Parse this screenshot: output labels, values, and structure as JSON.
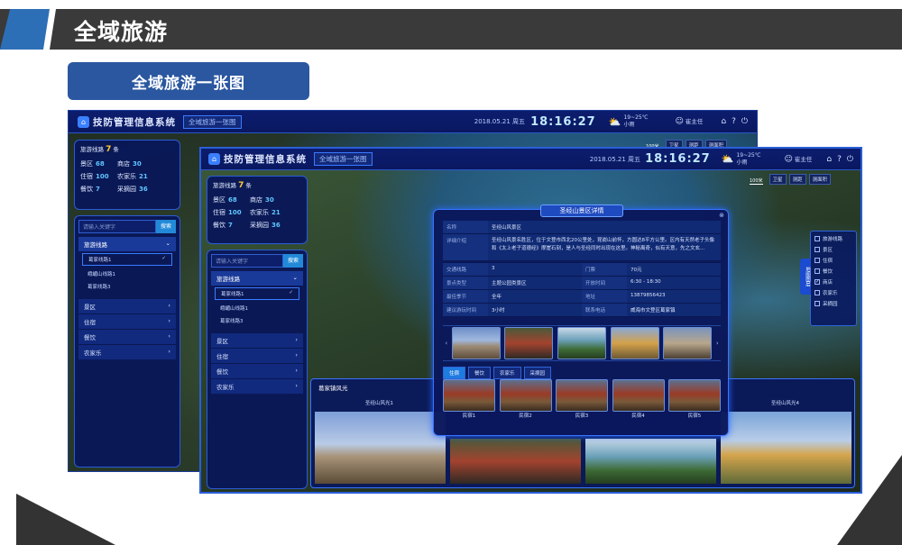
{
  "slide": {
    "title": "全域旅游",
    "subtitle": "全域旅游一张图"
  },
  "app": {
    "system_name": "技防管理信息系统",
    "active_tab": "全域旅游一张图",
    "date": "2018.05.21 周五",
    "time": "18:16:27",
    "weather_temp": "19~25℃",
    "weather_desc": "小雨",
    "user": "崔主任",
    "scale": "100米",
    "map_tools": [
      "卫星",
      "测距",
      "测面积"
    ]
  },
  "stats": {
    "route_label": "旅游线路",
    "route_count": "7",
    "route_unit": "条",
    "items": [
      {
        "label": "景区",
        "value": "68"
      },
      {
        "label": "商店",
        "value": "30"
      },
      {
        "label": "住宿",
        "value": "100"
      },
      {
        "label": "农家乐",
        "value": "21"
      },
      {
        "label": "餐饮",
        "value": "7"
      },
      {
        "label": "采摘园",
        "value": "36"
      }
    ]
  },
  "sidebar": {
    "search_placeholder": "请输入关键字",
    "search_button": "搜索",
    "route_menu": "旅游线路",
    "routes": [
      "葛家线路1",
      "峨嵋山线路1",
      "葛家线路3"
    ],
    "categories": [
      "景区",
      "住宿",
      "餐饮",
      "农家乐"
    ]
  },
  "detail": {
    "title": "圣经山景区详情",
    "rows": [
      {
        "k": "名称",
        "v": "圣经山风景区"
      },
      {
        "k": "详细介绍",
        "v": "圣经山风景名胜区，位于文登市西北20公里处，昆嵛山前怀，方圆达8平方公里。区内有天然老子头像和《太上老子道德经》摩崖石刻，是人与圣经同时出现在这里。神秘离奇，似有天意，先之文玄..."
      }
    ],
    "pairs": [
      {
        "k1": "交通线路",
        "v1": "3",
        "k2": "门票",
        "v2": "70元"
      },
      {
        "k1": "景点类型",
        "v1": "主题公园类景区",
        "k2": "开放时间",
        "v2": "6:30 - 18:30"
      },
      {
        "k1": "最佳季节",
        "v1": "全年",
        "k2": "地址",
        "v2": "13879856423"
      },
      {
        "k1": "建议游玩时间",
        "v1": "3小时",
        "k2": "联系电话",
        "v2": "威海市文登区葛家镇"
      }
    ],
    "tabs": [
      "住宿",
      "餐饮",
      "农家乐",
      "采摘园"
    ],
    "folk": [
      "民宿1",
      "民宿2",
      "民宿3",
      "民宿4",
      "民宿5"
    ]
  },
  "layers": {
    "title": "地图图层",
    "items": [
      {
        "label": "旅游线路",
        "checked": false
      },
      {
        "label": "景区",
        "checked": false
      },
      {
        "label": "住宿",
        "checked": false
      },
      {
        "label": "餐饮",
        "checked": false
      },
      {
        "label": "商店",
        "checked": true
      },
      {
        "label": "农家乐",
        "checked": false
      },
      {
        "label": "采摘园",
        "checked": false
      }
    ]
  },
  "strip": {
    "title": "葛家镇风光",
    "caption_left": "圣经山风光1",
    "caption_right": "圣经山风光4"
  }
}
